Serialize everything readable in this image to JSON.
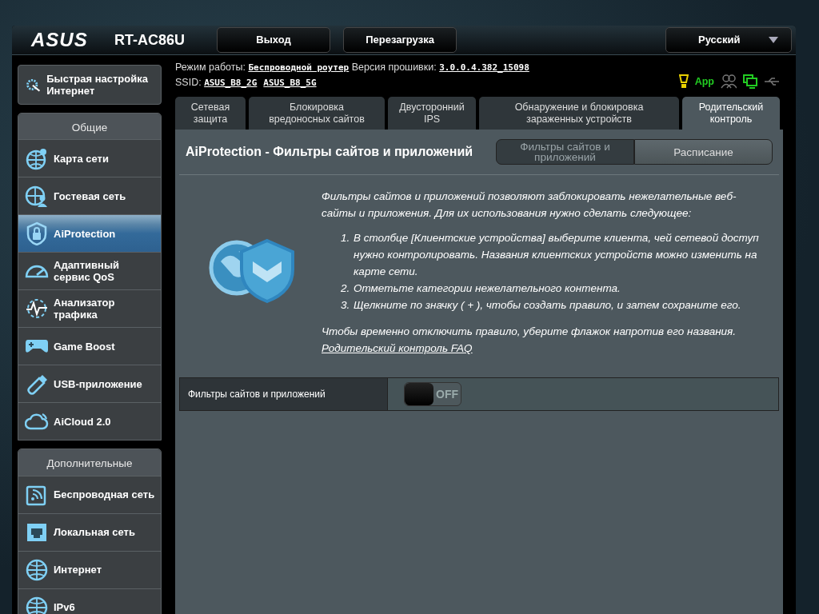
{
  "header": {
    "logo": "ASUS",
    "model": "RT-AC86U",
    "buttons": [
      "Выход",
      "Перезагрузка"
    ],
    "language": "Русский"
  },
  "info": {
    "mode_label": "Режим работы:",
    "mode": "Беспроводной роутер",
    "firmware_label": "Версия прошивки:",
    "firmware": "3.0.0.4.382_15098",
    "ssid_label": "SSID:",
    "ssids": [
      "ASUS_B8_2G",
      "ASUS_B8_5G"
    ],
    "app": "App"
  },
  "quick_setup": "Быстрая настройка Интернет",
  "sidebar": [
    {
      "heading": "Общие",
      "items": [
        {
          "label": "Карта сети",
          "selected": false
        },
        {
          "label": "Гостевая сеть",
          "selected": false
        },
        {
          "label": "AiProtection",
          "selected": true
        },
        {
          "label": "Адаптивный сервис QoS",
          "selected": false
        },
        {
          "label": "Анализатор трафика",
          "selected": false
        },
        {
          "label": "Game Boost",
          "selected": false
        },
        {
          "label": "USB-приложение",
          "selected": false
        },
        {
          "label": "AiCloud 2.0",
          "selected": false
        }
      ]
    },
    {
      "heading": "Дополнительные",
      "items": [
        {
          "label": "Беспроводная сеть",
          "selected": false
        },
        {
          "label": "Локальная сеть",
          "selected": false
        },
        {
          "label": "Интернет",
          "selected": false
        },
        {
          "label": "IPv6",
          "selected": false
        }
      ]
    }
  ],
  "tabs": [
    {
      "label": "Сетевая защита",
      "selected": false
    },
    {
      "label": "Блокировка вредоносных сайтов",
      "selected": false
    },
    {
      "label": "Двусторонний IPS",
      "selected": false
    },
    {
      "label": "Обнаружение и блокировка зараженных устройств",
      "selected": false
    },
    {
      "label": "Родительский контроль",
      "selected": true
    }
  ],
  "page": {
    "title": "AiProtection - Фильтры сайтов и приложений",
    "subtabs": [
      {
        "label": "Фильтры сайтов и приложений",
        "selected": true
      },
      {
        "label": "Расписание",
        "selected": false
      }
    ],
    "intro": "Фильтры сайтов и приложений позволяют заблокировать нежелательные веб-сайты и приложения. Для их использования нужно сделать следующее:",
    "steps": [
      {
        "number": "1.",
        "text": "В столбце [Клиентские устройства] выберите клиента, чей сетевой доступ нужно контролировать. Названия клиентских устройств можно изменить на карте сети."
      },
      {
        "number": "2.",
        "text": "Отметьте категории нежелательного контента."
      },
      {
        "number": "3.",
        "text": "Щелкните по значку ( + ), чтобы создать правило, и затем сохраните его."
      }
    ],
    "note": "Чтобы временно отключить правило, уберите флажок напротив его названия.",
    "faq_link": "Родительский контроль FAQ",
    "setting": {
      "label": "Фильтры сайтов и приложений",
      "on": false,
      "state_text": "OFF"
    }
  }
}
